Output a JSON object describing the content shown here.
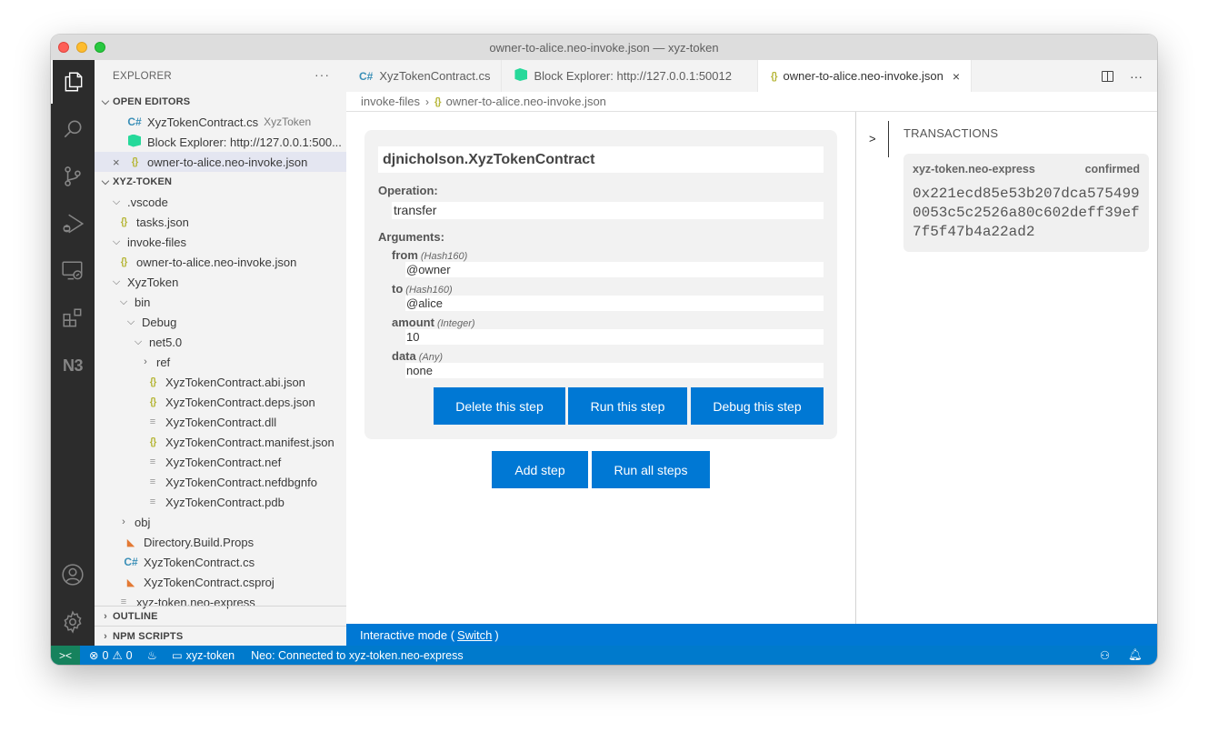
{
  "window": {
    "title": "owner-to-alice.neo-invoke.json — xyz-token"
  },
  "activity_bar": {
    "items": [
      {
        "name": "explorer",
        "icon": "files-icon",
        "active": true
      },
      {
        "name": "search",
        "icon": "search-icon"
      },
      {
        "name": "source-control",
        "icon": "source-control-icon"
      },
      {
        "name": "run-debug",
        "icon": "run-debug-icon"
      },
      {
        "name": "remote-explorer",
        "icon": "remote-explorer-icon"
      },
      {
        "name": "extensions",
        "icon": "extensions-icon"
      },
      {
        "name": "neo",
        "label": "N3"
      }
    ],
    "bottom": [
      {
        "name": "accounts",
        "icon": "account-icon"
      },
      {
        "name": "manage",
        "icon": "gear-icon"
      }
    ]
  },
  "sidebar": {
    "title": "EXPLORER",
    "more": "···",
    "open_editors": {
      "title": "OPEN EDITORS",
      "items": [
        {
          "icon": "csharp-icon",
          "label": "XyzTokenContract.cs",
          "desc": "XyzToken"
        },
        {
          "icon": "block-explorer-icon",
          "label": "Block Explorer: http://127.0.0.1:500..."
        },
        {
          "icon": "json-icon",
          "label": "owner-to-alice.neo-invoke.json",
          "selected": true
        }
      ]
    },
    "workspace": {
      "title": "XYZ-TOKEN",
      "items": [
        {
          "label": ".vscode",
          "type": "folder-open",
          "depth": 1
        },
        {
          "label": "tasks.json",
          "type": "json",
          "depth": 1
        },
        {
          "label": "invoke-files",
          "type": "folder-open",
          "depth": 1
        },
        {
          "label": "owner-to-alice.neo-invoke.json",
          "type": "json",
          "depth": 1
        },
        {
          "label": "XyzToken",
          "type": "folder-open",
          "depth": 1
        },
        {
          "label": "bin",
          "type": "folder-open",
          "depth": 2
        },
        {
          "label": "Debug",
          "type": "folder-open",
          "depth": 3
        },
        {
          "label": "net5.0",
          "type": "folder-open",
          "depth": 4
        },
        {
          "label": "ref",
          "type": "folder-closed",
          "depth": 5
        },
        {
          "label": "XyzTokenContract.abi.json",
          "type": "json",
          "depth": 5
        },
        {
          "label": "XyzTokenContract.deps.json",
          "type": "json",
          "depth": 5
        },
        {
          "label": "XyzTokenContract.dll",
          "type": "text",
          "depth": 5
        },
        {
          "label": "XyzTokenContract.manifest.json",
          "type": "json",
          "depth": 5
        },
        {
          "label": "XyzTokenContract.nef",
          "type": "text",
          "depth": 5
        },
        {
          "label": "XyzTokenContract.nefdbgnfo",
          "type": "text",
          "depth": 5
        },
        {
          "label": "XyzTokenContract.pdb",
          "type": "text",
          "depth": 5
        },
        {
          "label": "obj",
          "type": "folder-closed",
          "depth": 2
        },
        {
          "label": "Directory.Build.Props",
          "type": "rss",
          "depth": 2
        },
        {
          "label": "XyzTokenContract.cs",
          "type": "cs",
          "depth": 2
        },
        {
          "label": "XyzTokenContract.csproj",
          "type": "rss",
          "depth": 2
        },
        {
          "label": "xyz-token.neo-express",
          "type": "text",
          "depth": 1
        }
      ]
    },
    "outline": "OUTLINE",
    "npm_scripts": "NPM SCRIPTS"
  },
  "tabs": [
    {
      "icon": "csharp-icon",
      "label": "XyzTokenContract.cs"
    },
    {
      "icon": "block-explorer-icon",
      "label": "Block Explorer: http://127.0.0.1:50012"
    },
    {
      "icon": "json-icon",
      "label": "owner-to-alice.neo-invoke.json",
      "active": true
    }
  ],
  "breadcrumb": {
    "folder": "invoke-files",
    "file": "owner-to-alice.neo-invoke.json"
  },
  "step": {
    "contract": "djnicholson.XyzTokenContract",
    "operation_label": "Operation:",
    "operation": "transfer",
    "arguments_label": "Arguments:",
    "arguments": [
      {
        "name": "from",
        "type": "(Hash160)",
        "value": "@owner"
      },
      {
        "name": "to",
        "type": "(Hash160)",
        "value": "@alice"
      },
      {
        "name": "amount",
        "type": "(Integer)",
        "value": "10"
      },
      {
        "name": "data",
        "type": "(Any)",
        "value": "none"
      }
    ],
    "buttons": {
      "delete": "Delete this step",
      "run": "Run this step",
      "debug": "Debug this step"
    }
  },
  "actions": {
    "add": "Add step",
    "run_all": "Run all steps"
  },
  "transactions": {
    "toggle": ">",
    "title": "TRANSACTIONS",
    "items": [
      {
        "network": "xyz-token.neo-express",
        "status": "confirmed",
        "hash": "0x221ecd85e53b207dca5754990053c5c2526a80c602deff39ef7f5f47b4a22ad2"
      }
    ]
  },
  "panel_bar": {
    "text": "Interactive mode (",
    "link": "Switch",
    "end": ")"
  },
  "statusbar": {
    "errors": "0",
    "warnings": "0",
    "folder": "xyz-token",
    "neo": "Neo: Connected to xyz-token.neo-express"
  },
  "colors": {
    "accent": "#0078d4",
    "statusbar": "#007acc",
    "remote": "#16825d"
  }
}
